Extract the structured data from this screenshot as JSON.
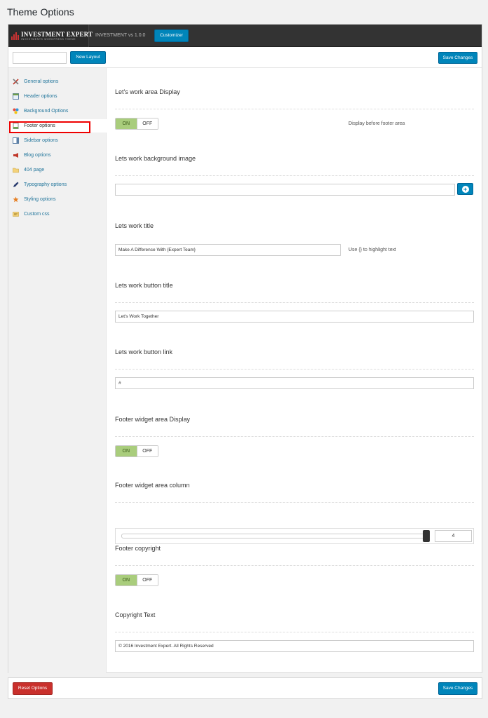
{
  "page": {
    "title": "Theme Options"
  },
  "header": {
    "logo_name": "INVESTMENT EXPERT",
    "logo_tagline": "INVESTMENTS WORDPRESS THEME",
    "version": "INVESTMENT vs 1.0.0",
    "customizer_label": "Customizer"
  },
  "toolbar": {
    "search_value": "",
    "new_layout_label": "New Layout",
    "save_label": "Save Changes"
  },
  "sidebar": {
    "items": [
      {
        "label": "General options",
        "icon": "wrench-pencil-icon"
      },
      {
        "label": "Header options",
        "icon": "layout-header-icon"
      },
      {
        "label": "Background Options",
        "icon": "palette-icon"
      },
      {
        "label": "Footer options",
        "icon": "footer-page-icon",
        "active": true
      },
      {
        "label": "Sidebar options",
        "icon": "sidebar-layout-icon"
      },
      {
        "label": "Blog options",
        "icon": "megaphone-icon"
      },
      {
        "label": "404 page",
        "icon": "folder-image-icon"
      },
      {
        "label": "Typography options",
        "icon": "pen-icon"
      },
      {
        "label": "Styling options",
        "icon": "paint-star-icon"
      },
      {
        "label": "Custom css",
        "icon": "css-card-icon"
      }
    ]
  },
  "fields": {
    "lets_work_display": {
      "label": "Let's work area Display",
      "on": "ON",
      "off": "OFF",
      "state": "on",
      "description": "Display before footer area"
    },
    "lets_work_bg": {
      "label": "Lets work background image",
      "value": ""
    },
    "lets_work_title": {
      "label": "Lets work title",
      "value": "Make A Difference With {Expert Team}",
      "description": "Use {} to highlight text"
    },
    "lets_work_button_title": {
      "label": "Lets work button title",
      "value": "Let's Work Together"
    },
    "lets_work_button_link": {
      "label": "Lets work button link",
      "value": "#"
    },
    "footer_widget_display": {
      "label": "Footer widget area Display",
      "on": "ON",
      "off": "OFF",
      "state": "on"
    },
    "footer_widget_column": {
      "label": "Footer widget area column",
      "value": "4",
      "min": 1,
      "max": 4
    },
    "footer_copyright": {
      "label": "Footer copyright",
      "on": "ON",
      "off": "OFF",
      "state": "on"
    },
    "copyright_text": {
      "label": "Copyright Text",
      "value": "© 2016 Investment Expert. All Rights Reserved"
    }
  },
  "bottom": {
    "reset_label": "Reset Options",
    "save_label": "Save Changes"
  },
  "colors": {
    "primary": "#0085ba",
    "danger": "#c9302c",
    "toggle_on": "#a9cd7c",
    "active_outline": "#ee0000"
  }
}
